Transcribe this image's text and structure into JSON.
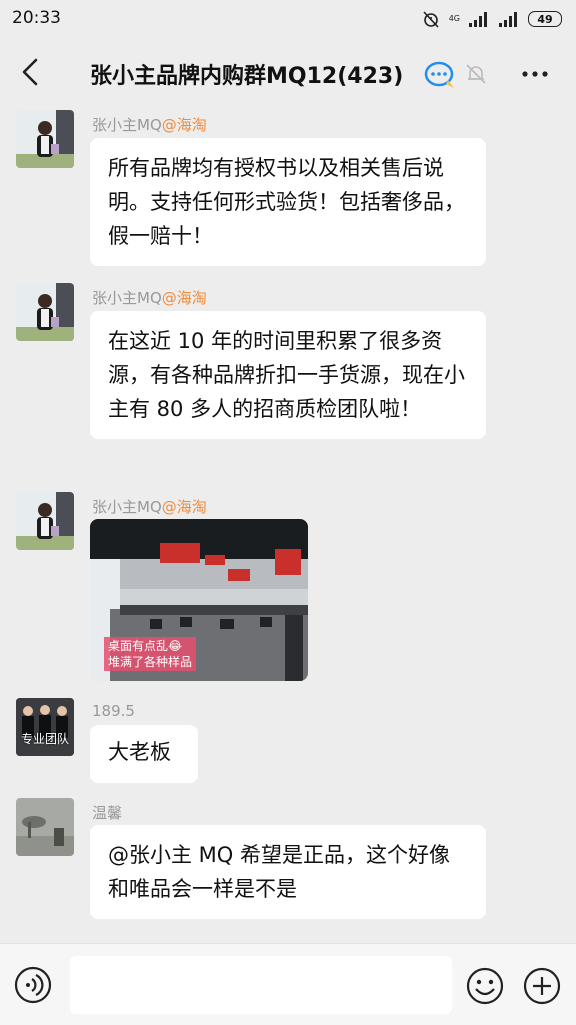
{
  "status_bar": {
    "time": "20:33",
    "battery": "49",
    "network": "4G"
  },
  "header": {
    "title": "张小主品牌内购群MQ12(423)"
  },
  "messages": [
    {
      "sender": "张小主MQ",
      "tag": "@海淘",
      "text": "所有品牌均有授权书以及相关售后说明。支持任何形式验货！包括奢侈品，假一赔十！"
    },
    {
      "sender": "张小主MQ",
      "tag": "@海淘",
      "text": "在这近 10 年的时间里积累了很多资源，有各种品牌折扣一手货源，现在小主有 80 多人的招商质检团队啦！"
    },
    {
      "sender": "张小主MQ",
      "tag": "@海淘",
      "image_caption": "桌面有点乱😂\n堆满了各种样品"
    },
    {
      "sender": "189.5",
      "avatar_text": "专业团队",
      "text": "大老板"
    },
    {
      "sender": "温馨",
      "text": "@张小主 MQ  希望是正品，这个好像和唯品会一样是不是"
    }
  ],
  "input_bar": {
    "placeholder": ""
  }
}
